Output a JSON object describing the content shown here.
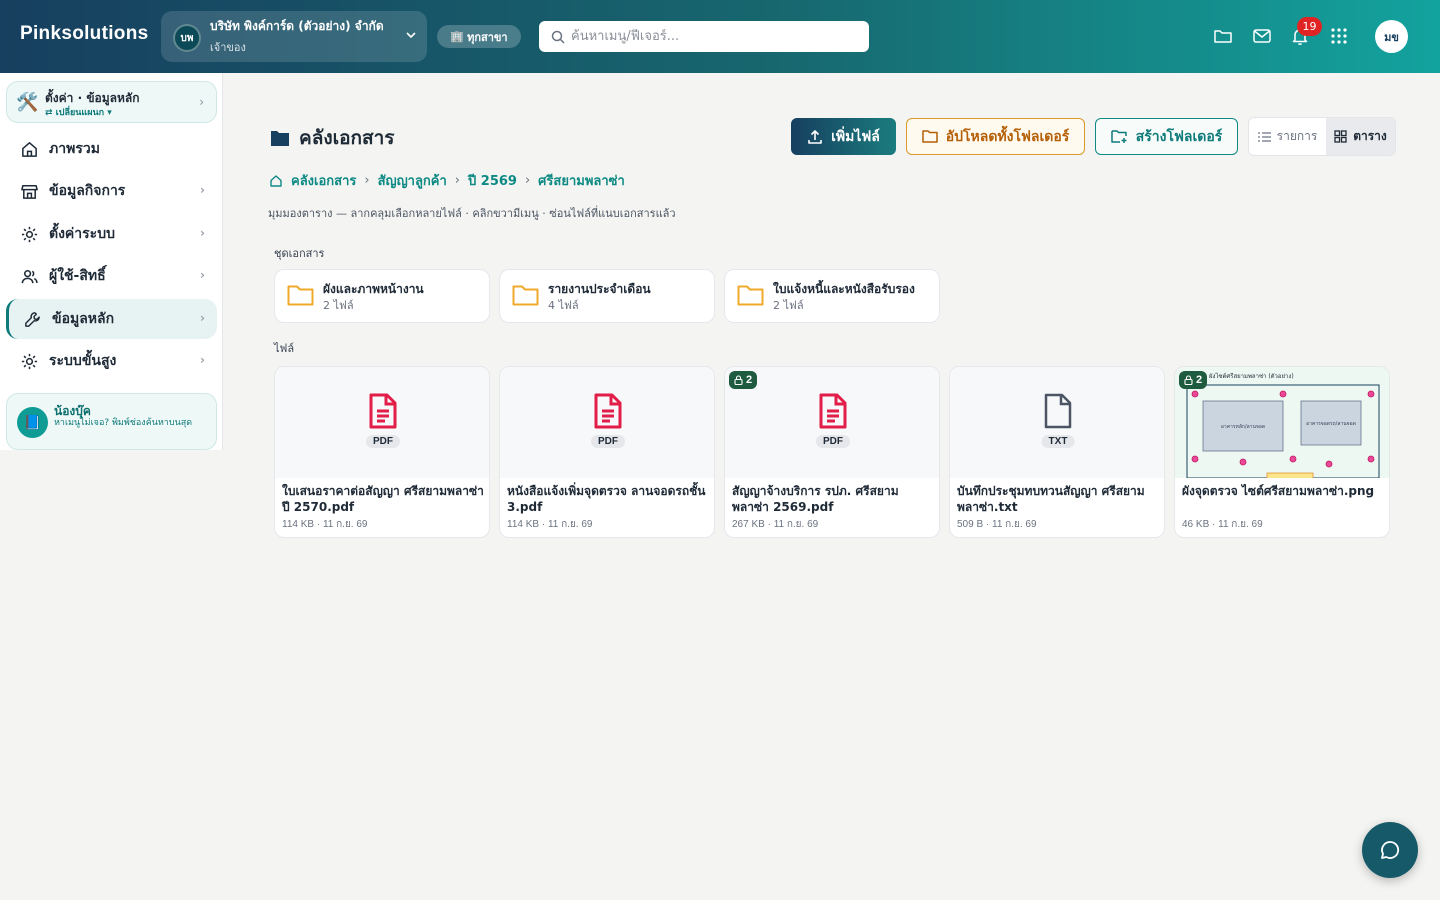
{
  "app": {
    "brand": "Pinksolutions"
  },
  "company": {
    "initials": "บพ",
    "name": "บริษัท พิงค์การ์ด (ตัวอย่าง) จำกัด",
    "role": "เจ้าของ"
  },
  "branch": {
    "icon": "🏢",
    "label": "ทุกสาขา"
  },
  "search": {
    "placeholder": "ค้นหาเมนู/ฟีเจอร์..."
  },
  "notifications": {
    "count": "19"
  },
  "user": {
    "initials": "มข"
  },
  "sidebar": {
    "top": {
      "emoji": "🛠️",
      "title": "ตั้งค่า · ข้อมูลหลัก",
      "sub": "⇄ เปลี่ยนแผนก ▾"
    },
    "items": [
      {
        "label": "ภาพรวม"
      },
      {
        "label": "ข้อมูลกิจการ"
      },
      {
        "label": "ตั้งค่าระบบ"
      },
      {
        "label": "ผู้ใช้-สิทธิ์"
      },
      {
        "label": "ข้อมูลหลัก"
      },
      {
        "label": "ระบบขั้นสูง"
      }
    ],
    "helper": {
      "emoji": "📘",
      "title": "น้องบุ๊ค",
      "text": "หาเมนูไม่เจอ? พิมพ์ช่องค้นหาบนสุด"
    }
  },
  "page": {
    "title": "คลังเอกสาร",
    "actions": {
      "add": "เพิ่มไฟล์",
      "upload_folder": "อัปโหลดทั้งโฟลเดอร์",
      "create_folder": "สร้างโฟลเดอร์"
    },
    "view": {
      "list": "รายการ",
      "grid": "ตาราง"
    },
    "breadcrumb": [
      "คลังเอกสาร",
      "สัญญาลูกค้า",
      "ปี 2569",
      "ศรีสยามพลาซ่า"
    ],
    "hint": "มุมมองตาราง — ลากคลุมเลือกหลายไฟล์ · คลิกขวามีเมนู · ซ่อนไฟล์ที่แนบเอกสารแล้ว",
    "folders_label": "ชุดเอกสาร",
    "folders": [
      {
        "name": "ผังและภาพหน้างาน",
        "count": "2 ไฟล์"
      },
      {
        "name": "รายงานประจำเดือน",
        "count": "4 ไฟล์"
      },
      {
        "name": "ใบแจ้งหนี้และหนังสือรับรอง",
        "count": "2 ไฟล์"
      }
    ],
    "files_label": "ไฟล์",
    "files": [
      {
        "ext": "PDF",
        "name": "ใบเสนอราคาต่อสัญญา ศรีสยามพลาซ่า ปี 2570.pdf",
        "meta": "114 KB · 11 ก.ย. 69",
        "lock": ""
      },
      {
        "ext": "PDF",
        "name": "หนังสือแจ้งเพิ่มจุดตรวจ ลานจอดรถชั้น 3.pdf",
        "meta": "114 KB · 11 ก.ย. 69",
        "lock": ""
      },
      {
        "ext": "PDF",
        "name": "สัญญาจ้างบริการ รปภ. ศรีสยามพลาซ่า 2569.pdf",
        "meta": "267 KB · 11 ก.ย. 69",
        "lock": "2"
      },
      {
        "ext": "TXT",
        "name": "บันทึกประชุมทบทวนสัญญา ศรีสยามพลาซ่า.txt",
        "meta": "509 B · 11 ก.ย. 69",
        "lock": ""
      },
      {
        "ext": "PNG",
        "name": "ผังจุดตรวจ ไซต์ศรีสยามพลาซ่า.png",
        "meta": "46 KB · 11 ก.ย. 69",
        "lock": "2",
        "preview": {
          "title": "ผังไซต์ศรีสยามพลาซ่า (ตัวอย่าง)",
          "box1": "อาคารหลัก/ลานจอด",
          "box2": "อาคารจอดรถ/ลานจอด"
        }
      }
    ]
  },
  "colors": {
    "accent": "#0e8a84",
    "pdf": "#e11d48",
    "folder": "#f0a92b"
  }
}
